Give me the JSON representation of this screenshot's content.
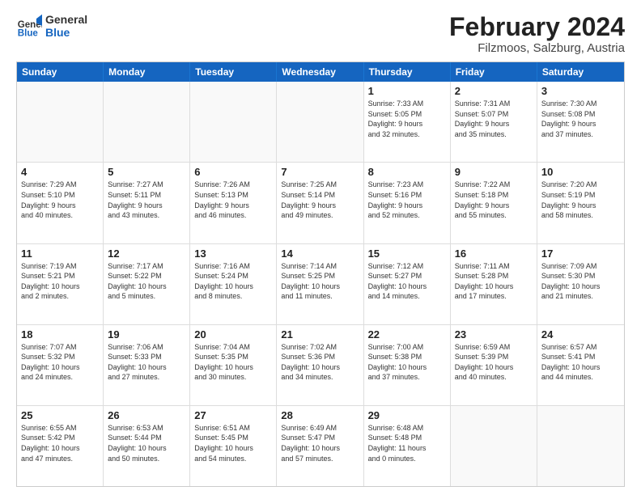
{
  "logo": {
    "general": "General",
    "blue": "Blue"
  },
  "title": "February 2024",
  "subtitle": "Filzmoos, Salzburg, Austria",
  "headers": [
    "Sunday",
    "Monday",
    "Tuesday",
    "Wednesday",
    "Thursday",
    "Friday",
    "Saturday"
  ],
  "rows": [
    [
      {
        "day": "",
        "info": "",
        "empty": true
      },
      {
        "day": "",
        "info": "",
        "empty": true
      },
      {
        "day": "",
        "info": "",
        "empty": true
      },
      {
        "day": "",
        "info": "",
        "empty": true
      },
      {
        "day": "1",
        "info": "Sunrise: 7:33 AM\nSunset: 5:05 PM\nDaylight: 9 hours\nand 32 minutes.",
        "empty": false
      },
      {
        "day": "2",
        "info": "Sunrise: 7:31 AM\nSunset: 5:07 PM\nDaylight: 9 hours\nand 35 minutes.",
        "empty": false
      },
      {
        "day": "3",
        "info": "Sunrise: 7:30 AM\nSunset: 5:08 PM\nDaylight: 9 hours\nand 37 minutes.",
        "empty": false
      }
    ],
    [
      {
        "day": "4",
        "info": "Sunrise: 7:29 AM\nSunset: 5:10 PM\nDaylight: 9 hours\nand 40 minutes.",
        "empty": false
      },
      {
        "day": "5",
        "info": "Sunrise: 7:27 AM\nSunset: 5:11 PM\nDaylight: 9 hours\nand 43 minutes.",
        "empty": false
      },
      {
        "day": "6",
        "info": "Sunrise: 7:26 AM\nSunset: 5:13 PM\nDaylight: 9 hours\nand 46 minutes.",
        "empty": false
      },
      {
        "day": "7",
        "info": "Sunrise: 7:25 AM\nSunset: 5:14 PM\nDaylight: 9 hours\nand 49 minutes.",
        "empty": false
      },
      {
        "day": "8",
        "info": "Sunrise: 7:23 AM\nSunset: 5:16 PM\nDaylight: 9 hours\nand 52 minutes.",
        "empty": false
      },
      {
        "day": "9",
        "info": "Sunrise: 7:22 AM\nSunset: 5:18 PM\nDaylight: 9 hours\nand 55 minutes.",
        "empty": false
      },
      {
        "day": "10",
        "info": "Sunrise: 7:20 AM\nSunset: 5:19 PM\nDaylight: 9 hours\nand 58 minutes.",
        "empty": false
      }
    ],
    [
      {
        "day": "11",
        "info": "Sunrise: 7:19 AM\nSunset: 5:21 PM\nDaylight: 10 hours\nand 2 minutes.",
        "empty": false
      },
      {
        "day": "12",
        "info": "Sunrise: 7:17 AM\nSunset: 5:22 PM\nDaylight: 10 hours\nand 5 minutes.",
        "empty": false
      },
      {
        "day": "13",
        "info": "Sunrise: 7:16 AM\nSunset: 5:24 PM\nDaylight: 10 hours\nand 8 minutes.",
        "empty": false
      },
      {
        "day": "14",
        "info": "Sunrise: 7:14 AM\nSunset: 5:25 PM\nDaylight: 10 hours\nand 11 minutes.",
        "empty": false
      },
      {
        "day": "15",
        "info": "Sunrise: 7:12 AM\nSunset: 5:27 PM\nDaylight: 10 hours\nand 14 minutes.",
        "empty": false
      },
      {
        "day": "16",
        "info": "Sunrise: 7:11 AM\nSunset: 5:28 PM\nDaylight: 10 hours\nand 17 minutes.",
        "empty": false
      },
      {
        "day": "17",
        "info": "Sunrise: 7:09 AM\nSunset: 5:30 PM\nDaylight: 10 hours\nand 21 minutes.",
        "empty": false
      }
    ],
    [
      {
        "day": "18",
        "info": "Sunrise: 7:07 AM\nSunset: 5:32 PM\nDaylight: 10 hours\nand 24 minutes.",
        "empty": false
      },
      {
        "day": "19",
        "info": "Sunrise: 7:06 AM\nSunset: 5:33 PM\nDaylight: 10 hours\nand 27 minutes.",
        "empty": false
      },
      {
        "day": "20",
        "info": "Sunrise: 7:04 AM\nSunset: 5:35 PM\nDaylight: 10 hours\nand 30 minutes.",
        "empty": false
      },
      {
        "day": "21",
        "info": "Sunrise: 7:02 AM\nSunset: 5:36 PM\nDaylight: 10 hours\nand 34 minutes.",
        "empty": false
      },
      {
        "day": "22",
        "info": "Sunrise: 7:00 AM\nSunset: 5:38 PM\nDaylight: 10 hours\nand 37 minutes.",
        "empty": false
      },
      {
        "day": "23",
        "info": "Sunrise: 6:59 AM\nSunset: 5:39 PM\nDaylight: 10 hours\nand 40 minutes.",
        "empty": false
      },
      {
        "day": "24",
        "info": "Sunrise: 6:57 AM\nSunset: 5:41 PM\nDaylight: 10 hours\nand 44 minutes.",
        "empty": false
      }
    ],
    [
      {
        "day": "25",
        "info": "Sunrise: 6:55 AM\nSunset: 5:42 PM\nDaylight: 10 hours\nand 47 minutes.",
        "empty": false
      },
      {
        "day": "26",
        "info": "Sunrise: 6:53 AM\nSunset: 5:44 PM\nDaylight: 10 hours\nand 50 minutes.",
        "empty": false
      },
      {
        "day": "27",
        "info": "Sunrise: 6:51 AM\nSunset: 5:45 PM\nDaylight: 10 hours\nand 54 minutes.",
        "empty": false
      },
      {
        "day": "28",
        "info": "Sunrise: 6:49 AM\nSunset: 5:47 PM\nDaylight: 10 hours\nand 57 minutes.",
        "empty": false
      },
      {
        "day": "29",
        "info": "Sunrise: 6:48 AM\nSunset: 5:48 PM\nDaylight: 11 hours\nand 0 minutes.",
        "empty": false
      },
      {
        "day": "",
        "info": "",
        "empty": true
      },
      {
        "day": "",
        "info": "",
        "empty": true
      }
    ]
  ]
}
